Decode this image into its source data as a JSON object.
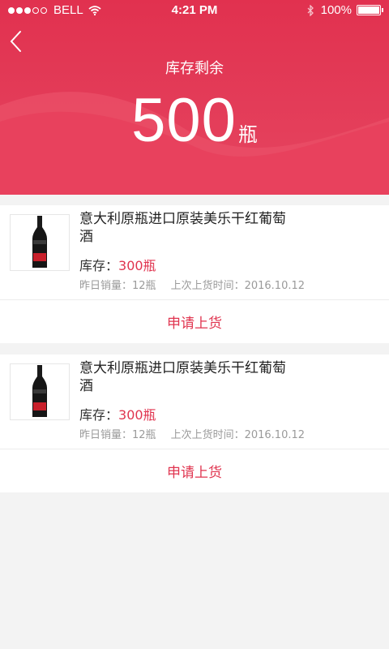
{
  "status_bar": {
    "carrier": "BELL",
    "time": "4:21 PM",
    "battery": "100%",
    "battery_level": 1.0
  },
  "header": {
    "title": "库存剩余",
    "total_value": "500",
    "total_unit": "瓶"
  },
  "products": [
    {
      "name": "意大利原瓶进口原装美乐干红葡萄酒",
      "stock_label": "库存：",
      "stock_value": "300瓶",
      "sales_label": "昨日销量：",
      "sales_value": "12瓶",
      "restock_label": "上次上货时间：",
      "restock_value": "2016.10.12",
      "action_label": "申请上货"
    },
    {
      "name": "意大利原瓶进口原装美乐干红葡萄酒",
      "stock_label": "库存：",
      "stock_value": "300瓶",
      "sales_label": "昨日销量：",
      "sales_value": "12瓶",
      "restock_label": "上次上货时间：",
      "restock_value": "2016.10.12",
      "action_label": "申请上货"
    }
  ],
  "colors": {
    "accent": "#e0344f",
    "header_top": "#e1314f",
    "background": "#f3f3f3"
  },
  "icons": {
    "back": "chevron-left-icon",
    "wifi": "wifi-icon",
    "bluetooth": "bluetooth-icon",
    "battery": "battery-icon",
    "signal": "signal-dots-icon"
  }
}
